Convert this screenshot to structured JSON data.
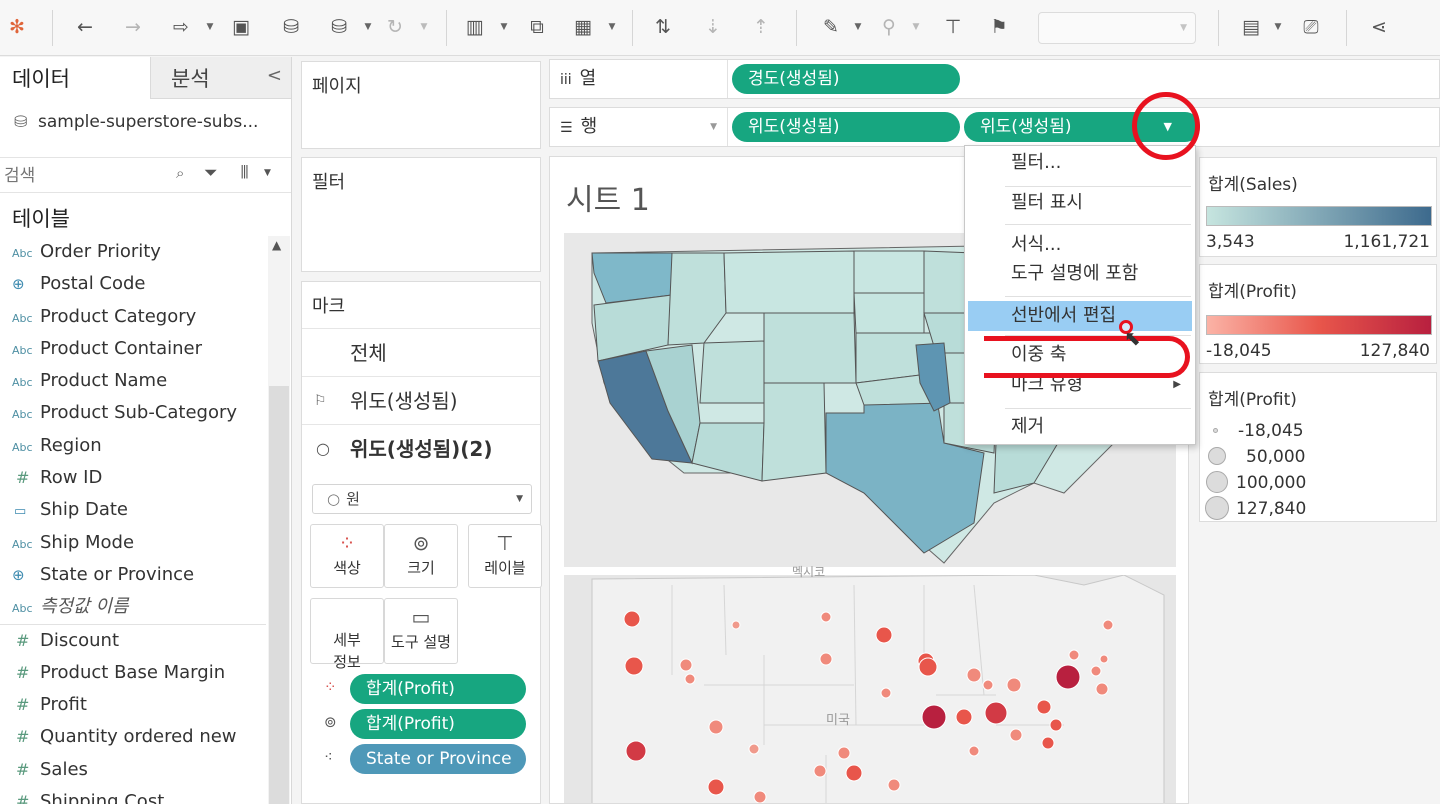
{
  "toolbar": {
    "icons": [
      "tableau-logo-icon",
      "undo-icon",
      "redo-icon",
      "replay-icon",
      "save-icon",
      "new-datasource-icon",
      "pause-update-icon",
      "refresh-icon",
      "new-worksheet-icon",
      "duplicate-icon",
      "clear-sheet-icon",
      "swap-icon",
      "sort-asc-icon",
      "sort-desc-icon",
      "highlight-icon",
      "group-icon",
      "label-icon",
      "pin-icon",
      "show-me-icon",
      "presentation-icon",
      "share-icon"
    ]
  },
  "data_pane": {
    "tab_data": "데이터",
    "tab_analysis": "분석",
    "collapse": "<",
    "datasource": "sample-superstore-subs...",
    "search_placeholder": "검색",
    "tables_heading": "테이블",
    "fields": [
      {
        "type": "Abc",
        "name": "Order Priority"
      },
      {
        "type": "globe",
        "name": "Postal Code"
      },
      {
        "type": "Abc",
        "name": "Product Category"
      },
      {
        "type": "Abc",
        "name": "Product Container"
      },
      {
        "type": "Abc",
        "name": "Product Name"
      },
      {
        "type": "Abc",
        "name": "Product Sub-Category"
      },
      {
        "type": "Abc",
        "name": "Region"
      },
      {
        "type": "#",
        "name": "Row ID"
      },
      {
        "type": "cal",
        "name": "Ship Date"
      },
      {
        "type": "Abc",
        "name": "Ship Mode"
      },
      {
        "type": "globe",
        "name": "State or Province"
      },
      {
        "type": "Abc",
        "name": "측정값 이름"
      }
    ],
    "measures": [
      {
        "type": "#",
        "name": "Discount"
      },
      {
        "type": "#",
        "name": "Product Base Margin"
      },
      {
        "type": "#",
        "name": "Profit"
      },
      {
        "type": "#",
        "name": "Quantity ordered new"
      },
      {
        "type": "#",
        "name": "Sales"
      },
      {
        "type": "#",
        "name": "Shipping Cost"
      }
    ]
  },
  "pages_card": {
    "title": "페이지"
  },
  "filters_card": {
    "title": "필터"
  },
  "marks_card": {
    "title": "마크",
    "all": "전체",
    "layer1": "위도(생성됨)",
    "layer2": "위도(생성됨)(2)",
    "mark_type": "원",
    "buttons": {
      "color": "색상",
      "size": "크기",
      "label": "레이블",
      "detail": "세부\n정보",
      "tooltip": "도구 설명"
    },
    "pills": [
      "합계(Profit)",
      "합계(Profit)",
      "State or Province"
    ]
  },
  "shelves": {
    "columns_label": "열",
    "rows_label": "행",
    "columns_pill": "경도(생성됨)",
    "rows_pills": [
      "위도(생성됨)",
      "위도(생성됨)"
    ]
  },
  "view": {
    "title": "시트 1",
    "map_label_top": "멕시코",
    "map_label_bottom": "미국"
  },
  "legends": {
    "sales": {
      "title": "합계(Sales)",
      "min": "3,543",
      "max": "1,161,721",
      "color_low": "#c6e5df",
      "color_high": "#3d6a8d"
    },
    "profit_color": {
      "title": "합계(Profit)",
      "min": "-18,045",
      "max": "127,840",
      "color_low": "#fbb3a6",
      "color_high": "#b8203f"
    },
    "profit_size": {
      "title": "합계(Profit)",
      "items": [
        "-18,045",
        "50,000",
        "100,000",
        "127,840"
      ]
    }
  },
  "context_menu": {
    "items": [
      "필터...",
      "필터 표시",
      "서식...",
      "도구 설명에 포함",
      "선반에서 편집",
      "이중 축",
      "마크 유형",
      "제거"
    ],
    "highlighted": "선반에서 편집"
  },
  "colors": {
    "pill_green": "#17a680",
    "pill_blue": "#4e98b8",
    "annotation_red": "#e8121f",
    "menu_highlight": "#99cdf3"
  }
}
